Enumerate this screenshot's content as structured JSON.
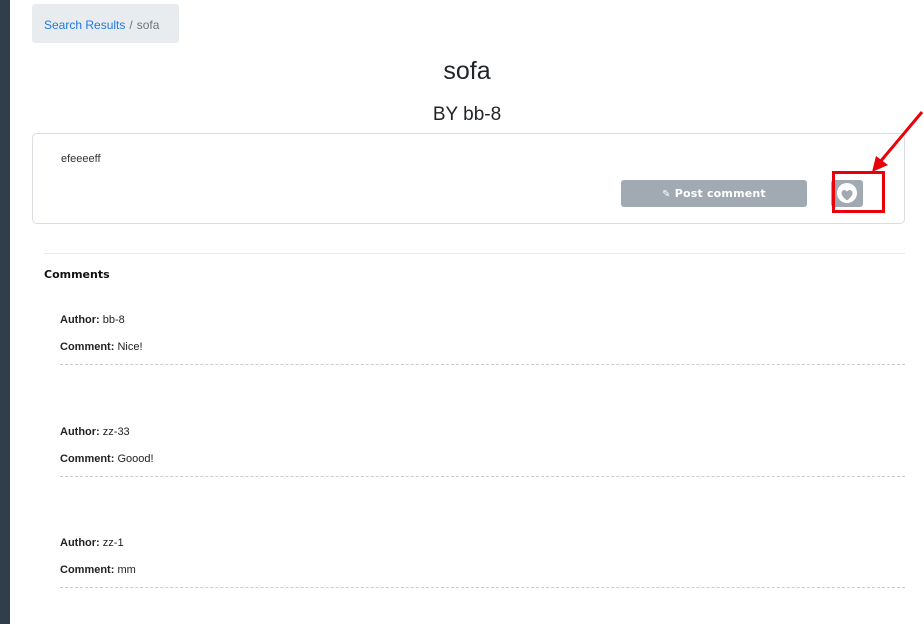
{
  "breadcrumb": {
    "link_label": "Search Results",
    "separator": "/",
    "current": "sofa"
  },
  "item": {
    "title": "sofa",
    "byline": "BY bb-8",
    "description": "efeeeeff"
  },
  "actions": {
    "post_comment_label": "Post comment",
    "post_comment_icon": "pencil-icon",
    "like_icon": "heart-icon"
  },
  "annotation": {
    "highlight_color": "#e8000b"
  },
  "comments_section": {
    "heading": "Comments",
    "author_label": "Author:",
    "comment_label": "Comment:",
    "items": [
      {
        "author": "bb-8",
        "comment": "Nice!"
      },
      {
        "author": "zz-33",
        "comment": "Goood!"
      },
      {
        "author": "zz-1",
        "comment": "mm"
      }
    ]
  }
}
